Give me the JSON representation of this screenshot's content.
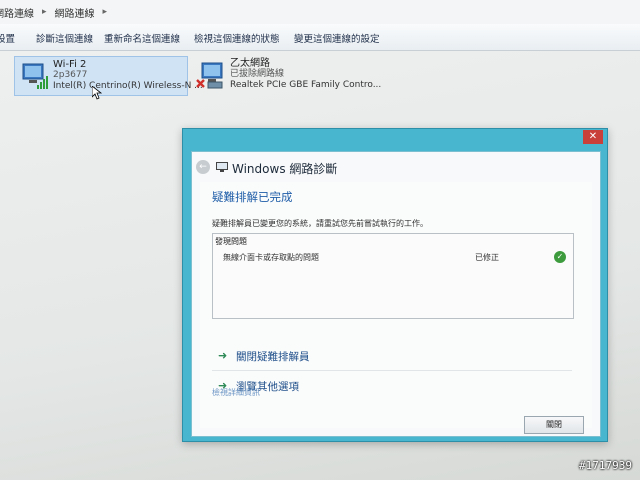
{
  "breadcrumb": {
    "items": [
      "網路連線",
      "網路連線"
    ],
    "separator": "▸"
  },
  "toolbar": {
    "items": [
      "設置",
      "診斷這個連線",
      "重新命名這個連線",
      "檢視這個連線的狀態",
      "變更這個連線的設定"
    ]
  },
  "adapters": [
    {
      "name": "Wi-Fi 2",
      "status": "2p3677",
      "device": "Intel(R) Centrino(R) Wireless-N ..."
    },
    {
      "name": "乙太網路",
      "status": "已拔除網路線",
      "device": "Realtek PCIe GBE Family Contro..."
    }
  ],
  "dialog": {
    "title": "Windows 網路診斷",
    "close_glyph": "✕",
    "back_glyph": "←",
    "heading": "疑難排解已完成",
    "description": "疑難排解員已變更您的系統，請重試您先前嘗試執行的工作。",
    "issues_header": "發現問題",
    "issue": {
      "name": "無線介面卡或存取點的問題",
      "status": "已修正",
      "icon": "check-icon"
    },
    "options": [
      {
        "label": "關閉疑難排解員",
        "arrow": "➜"
      },
      {
        "label": "瀏覽其他選項",
        "arrow": "➜"
      }
    ],
    "detail_link": "檢視詳細資訊",
    "close_button": "關閉"
  },
  "watermark": "#1717939",
  "colors": {
    "dialog_frame": "#49b6d0",
    "heading": "#1f5ea8",
    "check": "#3d9b3d"
  }
}
